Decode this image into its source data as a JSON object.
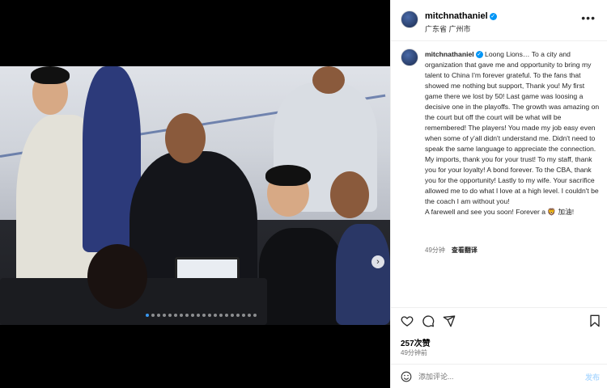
{
  "post": {
    "username": "mitchnathaniel",
    "location": "广东省 广州市",
    "more_icon": "more-horizontal-icon",
    "caption_username": "mitchnathaniel",
    "caption_text": "Loong Lions… To a city and organization that gave me and opportunity to bring my talent to China I'm forever grateful. To the fans that showed me nothing but support, Thank you! My first game there we lost by 50! Last game was loosing a decisive one in the playoffs. The growth was amazing on the court but off the court will be what will be remembered! The players! You made my job easy even when some of y'all didn't understand me. Didn't need to speak the same language to appreciate the connection. My imports, thank you for your trust! To my staff, thank you for your loyalty! A bond forever. To the CBA, thank you for the opportunity! Lastly to my wife. Your sacrifice allowed me to do what I love at a high level. I couldn't be the coach I am without you!",
    "caption_farewell": "A farewell and see you soon! Forever a 🦁 加油!",
    "caption_age": "49分钟",
    "translate_label": "查看翻译",
    "likes": "257次赞",
    "posted_ago": "49分钟前",
    "comment_placeholder": "添加评论...",
    "post_label": "发布",
    "carousel": {
      "total": 20,
      "active": 0
    }
  },
  "colors": {
    "accent": "#0095f6",
    "post_disabled": "#b3dbff",
    "muted": "#737373"
  },
  "icons": [
    "verified-badge-icon",
    "heart-icon",
    "comment-icon",
    "share-icon",
    "bookmark-icon",
    "emoji-icon",
    "chevron-right-icon"
  ]
}
